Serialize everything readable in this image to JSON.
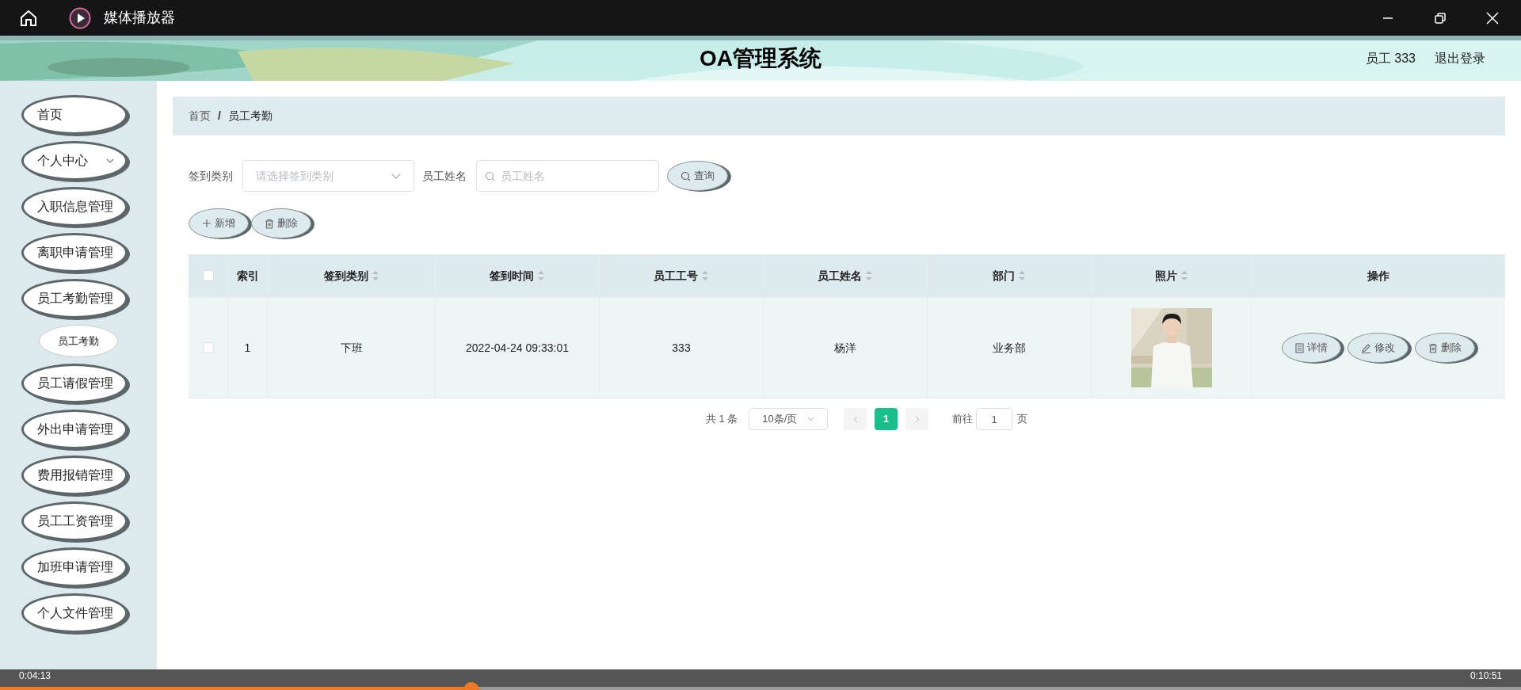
{
  "window": {
    "title": "媒体播放器"
  },
  "header": {
    "title": "OA管理系统",
    "user": "员工 333",
    "logout": "退出登录"
  },
  "sidebar": {
    "items": [
      {
        "label": "首页",
        "kind": "item",
        "selected": false
      },
      {
        "label": "个人中心",
        "kind": "group",
        "selected": false
      },
      {
        "label": "入职信息管理",
        "kind": "group",
        "selected": false
      },
      {
        "label": "离职申请管理",
        "kind": "group",
        "selected": false
      },
      {
        "label": "员工考勤管理",
        "kind": "group",
        "selected": false
      },
      {
        "label": "员工考勤",
        "kind": "sub",
        "selected": true
      },
      {
        "label": "员工请假管理",
        "kind": "group",
        "selected": false
      },
      {
        "label": "外出申请管理",
        "kind": "group",
        "selected": false
      },
      {
        "label": "费用报销管理",
        "kind": "group",
        "selected": false
      },
      {
        "label": "员工工资管理",
        "kind": "group",
        "selected": false
      },
      {
        "label": "加班申请管理",
        "kind": "group",
        "selected": false
      },
      {
        "label": "个人文件管理",
        "kind": "group",
        "selected": false
      }
    ]
  },
  "breadcrumb": {
    "items": [
      "首页",
      "员工考勤"
    ],
    "separator": "/"
  },
  "filters": {
    "type_label": "签到类别",
    "type_placeholder": "请选择签到类别",
    "name_label": "员工姓名",
    "name_placeholder": "员工姓名",
    "query": "查询"
  },
  "actions": [
    "新增",
    "删除"
  ],
  "table": {
    "all_checked": false,
    "columns": [
      {
        "label": "索引",
        "sortable": false
      },
      {
        "label": "签到类别",
        "sortable": true
      },
      {
        "label": "签到时间",
        "sortable": true
      },
      {
        "label": "员工工号",
        "sortable": true
      },
      {
        "label": "员工姓名",
        "sortable": true
      },
      {
        "label": "部门",
        "sortable": true
      },
      {
        "label": "照片",
        "sortable": true
      },
      {
        "label": "操作",
        "sortable": false
      }
    ],
    "rows": [
      {
        "checked": false,
        "cells": [
          "1",
          "下班",
          "2022-04-24 09:33:01",
          "333",
          "杨洋",
          "业务部"
        ],
        "buttons": [
          "详情",
          "修改",
          "删除"
        ]
      }
    ]
  },
  "pagination": {
    "total": "共 1 条",
    "page_size": "10条/页",
    "pages": [
      {
        "label": "1",
        "selected": true
      }
    ],
    "goto": "前往",
    "goto_value": "1",
    "page_unit": "页"
  },
  "player": {
    "elapsed": "0:04:13",
    "duration": "0:10:51",
    "level": 0.31
  }
}
